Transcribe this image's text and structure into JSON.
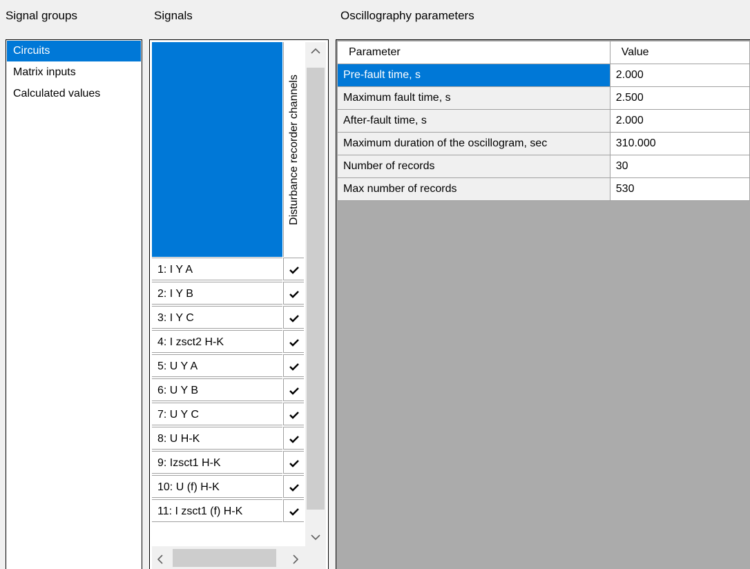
{
  "headers": {
    "signal_groups": "Signal groups",
    "signals": "Signals",
    "oscillography": "Oscillography parameters"
  },
  "signal_groups": [
    "Circuits",
    "Matrix inputs",
    "Calculated values"
  ],
  "signals": {
    "column_header": "Disturbance recorder channels",
    "rows": [
      {
        "name": "1: I Y A",
        "checked": true
      },
      {
        "name": "2: I Y B",
        "checked": true
      },
      {
        "name": "3: I Y C",
        "checked": true
      },
      {
        "name": "4: I zsct2 H-K",
        "checked": true
      },
      {
        "name": "5: U Y A",
        "checked": true
      },
      {
        "name": "6: U Y B",
        "checked": true
      },
      {
        "name": "7: U Y C",
        "checked": true
      },
      {
        "name": "8: U H-K",
        "checked": true
      },
      {
        "name": "9: Izsct1 H-K",
        "checked": true
      },
      {
        "name": "10: U (f) H-K",
        "checked": true
      },
      {
        "name": "11: I zsct1 (f) H-K",
        "checked": true
      }
    ]
  },
  "params": {
    "col_parameter": "Parameter",
    "col_value": "Value",
    "rows": [
      {
        "name": "Pre-fault time, s",
        "value": "2.000"
      },
      {
        "name": "Maximum fault time, s",
        "value": "2.500"
      },
      {
        "name": "After-fault time, s",
        "value": "2.000"
      },
      {
        "name": "Maximum duration of the oscillogram, sec",
        "value": "310.000"
      },
      {
        "name": "Number of records",
        "value": "30"
      },
      {
        "name": "Max number of records",
        "value": "530"
      }
    ]
  },
  "colors": {
    "selection": "#0078d7",
    "empty_area": "#ababab"
  },
  "icons": {
    "check": "check-icon",
    "scroll_up": "chevron-up-icon",
    "scroll_down": "chevron-down-icon",
    "scroll_left": "chevron-left-icon",
    "scroll_right": "chevron-right-icon"
  }
}
